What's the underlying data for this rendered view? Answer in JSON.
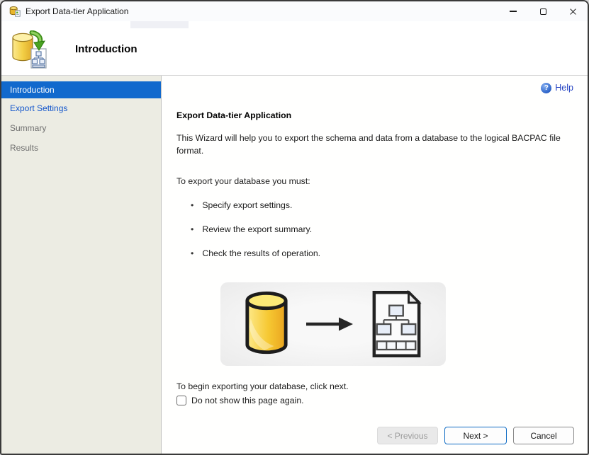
{
  "window": {
    "title": "Export Data-tier Application",
    "controls": {
      "minimize": "minimize-button",
      "maximize": "maximize-button",
      "close": "close-button"
    }
  },
  "header": {
    "title": "Introduction"
  },
  "sidebar": {
    "items": [
      {
        "label": "Introduction",
        "state": "active"
      },
      {
        "label": "Export Settings",
        "state": "enabled"
      },
      {
        "label": "Summary",
        "state": "disabled"
      },
      {
        "label": "Results",
        "state": "disabled"
      }
    ]
  },
  "content": {
    "help": {
      "label": "Help",
      "icon_glyph": "?"
    },
    "heading": "Export Data-tier Application",
    "description": "This Wizard will help you to export the schema and data from a database to the logical BACPAC file format.",
    "steps_intro": "To export your database you must:",
    "bullet_glyph": "•",
    "steps": [
      "Specify export settings.",
      "Review the export summary.",
      "Check the results of operation."
    ],
    "begin_text": "To begin exporting your database, click next.",
    "checkbox": {
      "label": "Do not show this page again.",
      "checked": false
    }
  },
  "footer": {
    "previous_label": "< Previous",
    "next_label": "Next >",
    "cancel_label": "Cancel"
  },
  "colors": {
    "selected_item_bg": "#1169cd",
    "sidebar_link_blue": "#1255cc",
    "help_link_blue": "#2543c2",
    "next_button_border": "#0f6cc4",
    "sidebar_bg": "#ECECE3",
    "database_yellow": "#f5c93c"
  }
}
